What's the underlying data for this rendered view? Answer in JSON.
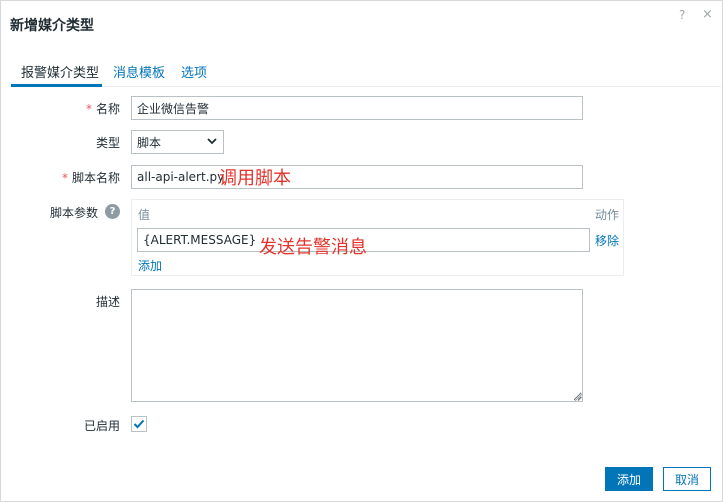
{
  "dialog": {
    "title": "新增媒介类型"
  },
  "header_icons": {
    "help": "?",
    "close": "×"
  },
  "tabs": [
    {
      "label": "报警媒介类型",
      "active": true
    },
    {
      "label": "消息模板",
      "active": false
    },
    {
      "label": "选项",
      "active": false
    }
  ],
  "form": {
    "name": {
      "label": "名称",
      "value": "企业微信告警",
      "required": true
    },
    "type": {
      "label": "类型",
      "value": "脚本"
    },
    "script_name": {
      "label": "脚本名称",
      "value": "all-api-alert.py",
      "required": true
    },
    "script_params": {
      "label": "脚本参数",
      "col_value": "值",
      "col_action": "动作",
      "rows": [
        {
          "value": "{ALERT.MESSAGE}",
          "action": "移除"
        }
      ],
      "add_label": "添加"
    },
    "description": {
      "label": "描述",
      "value": ""
    },
    "enabled": {
      "label": "已启用",
      "checked": true
    }
  },
  "annotations": {
    "script_note": "调用脚本",
    "param_note": "发送告警消息"
  },
  "buttons": {
    "add": "添加",
    "cancel": "取消"
  },
  "colors": {
    "accent": "#0275b8",
    "annotation": "#e4332c",
    "required": "#e45959"
  }
}
